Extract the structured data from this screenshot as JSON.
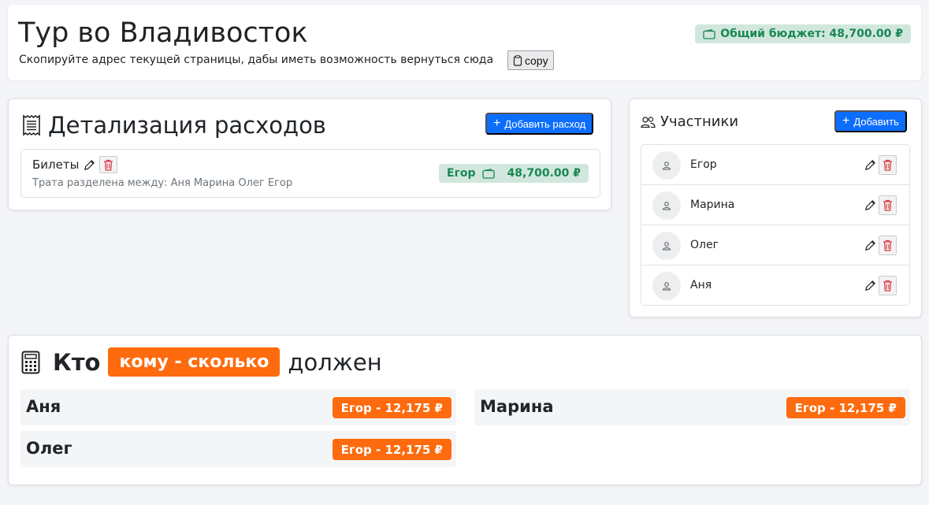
{
  "header": {
    "title": "Тур во Владивосток",
    "subtitle": "Скопируйте адрес текущей страницы, дабы иметь возможность вернуться сюда",
    "copy_label": "copy",
    "budget": "Общий бюджет: 48,700.00 ₽"
  },
  "expenses": {
    "title": "Детализация расходов",
    "add_label": "Добавить расход",
    "items": [
      {
        "name": "Билеты",
        "split": "Трата разделена между: Аня Марина Олег Егор",
        "payer": "Егор",
        "amount": "48,700.00 ₽"
      }
    ]
  },
  "participants": {
    "title": "Участники",
    "add_label": "Добавить",
    "items": [
      "Егор",
      "Марина",
      "Олег",
      "Аня"
    ]
  },
  "debts": {
    "title_start": "Кто",
    "title_highlight": "кому - сколько",
    "title_end": "должен",
    "items": [
      {
        "debtor": "Аня",
        "text": "Егор - 12,175 ₽"
      },
      {
        "debtor": "Марина",
        "text": "Егор - 12,175 ₽"
      },
      {
        "debtor": "Олег",
        "text": "Егор - 12,175 ₽"
      }
    ]
  },
  "colors": {
    "primary": "#0d6efd",
    "success_bg": "#d1e7dd",
    "success_text": "#198754",
    "accent": "#fd6b0e",
    "danger": "#dc3545"
  }
}
